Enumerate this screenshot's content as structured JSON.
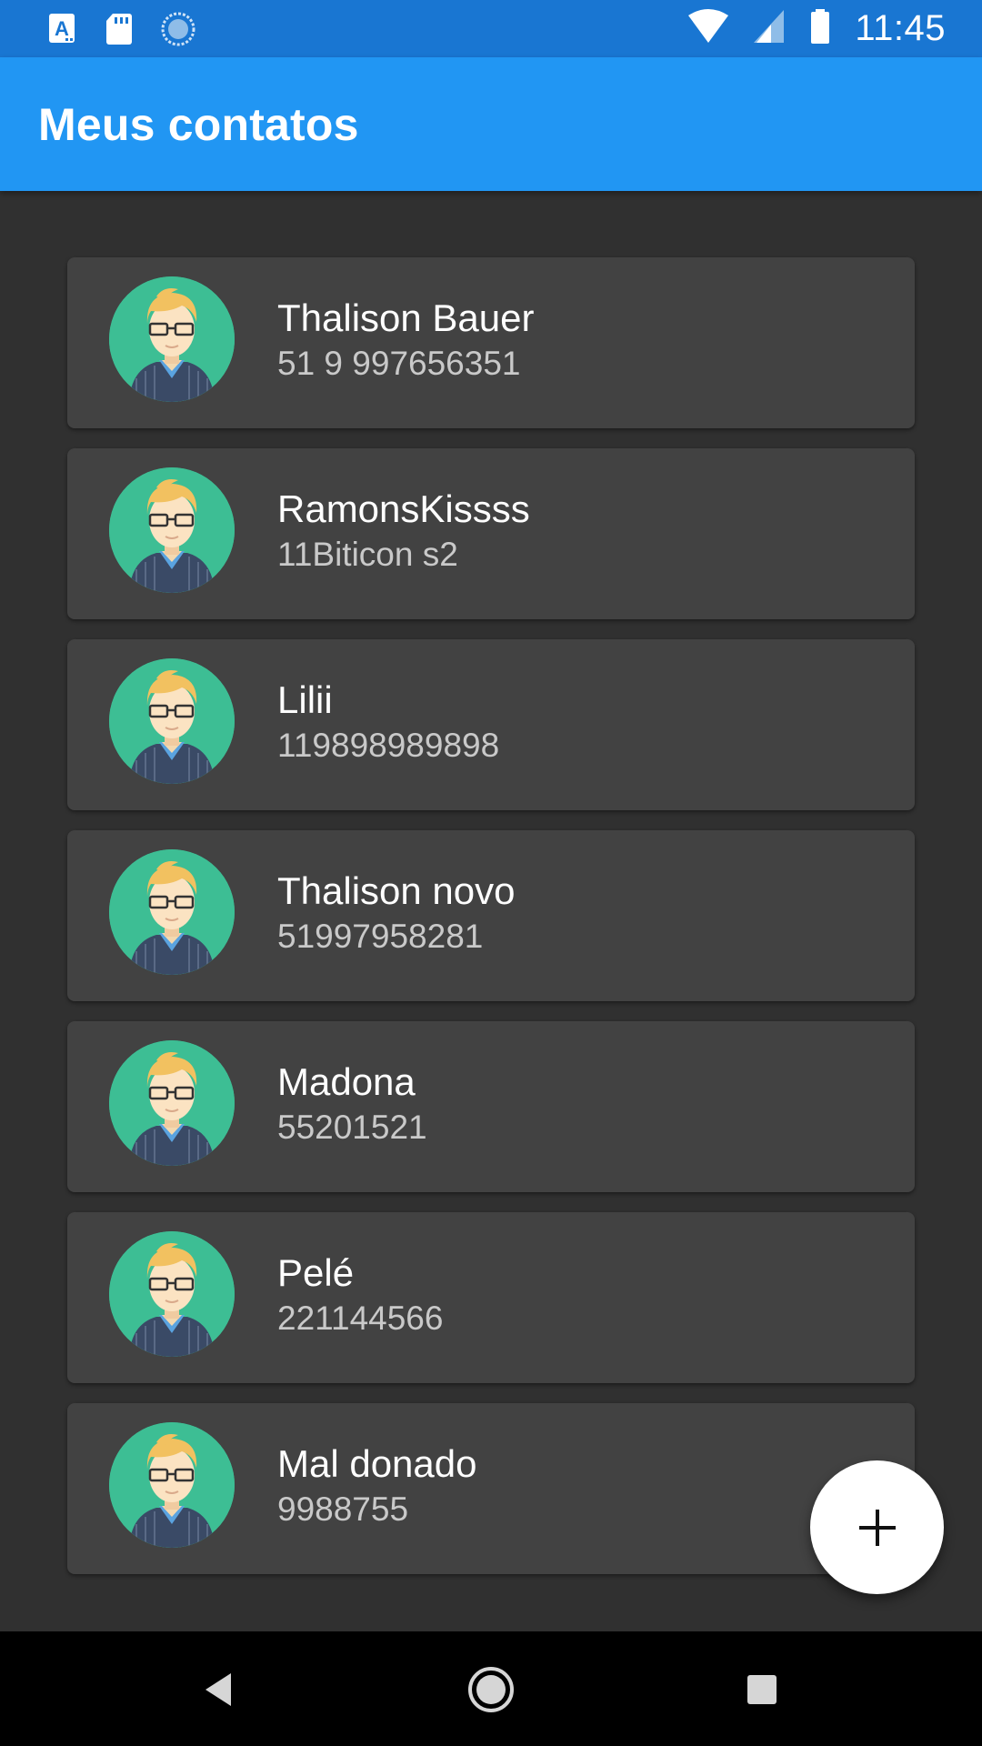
{
  "status_bar": {
    "time": "11:45",
    "left_icons": [
      "text-a-notification-icon",
      "sd-card-icon",
      "sync-circle-icon"
    ],
    "right_icons": [
      "wifi-icon",
      "cell-signal-icon",
      "battery-icon"
    ]
  },
  "app_bar": {
    "title": "Meus contatos"
  },
  "contacts": [
    {
      "name": "Thalison Bauer",
      "phone": "51 9 997656351"
    },
    {
      "name": "RamonsKissss",
      "phone": "11Biticon s2"
    },
    {
      "name": "Lilii",
      "phone": "119898989898"
    },
    {
      "name": "Thalison novo",
      "phone": "51997958281"
    },
    {
      "name": "Madona",
      "phone": "55201521"
    },
    {
      "name": "Pelé",
      "phone": "221144566"
    },
    {
      "name": "Mal donado",
      "phone": "9988755"
    }
  ],
  "fab": {
    "icon": "plus-icon"
  },
  "nav_bar": {
    "buttons": [
      "back-icon",
      "home-icon",
      "recents-icon"
    ]
  },
  "colors": {
    "status_bar": "#1976D2",
    "app_bar": "#2196F3",
    "background": "#303030",
    "card": "#424242",
    "avatar_bg": "#3DBE94"
  }
}
